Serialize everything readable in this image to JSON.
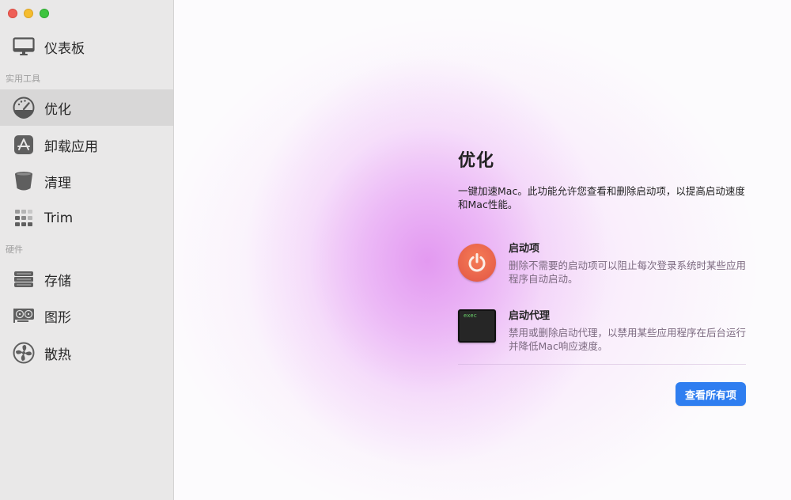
{
  "window": {
    "controls": [
      "close",
      "minimize",
      "maximize"
    ]
  },
  "sidebar": {
    "top_item": {
      "label": "仪表板",
      "icon": "monitor-icon"
    },
    "sections": [
      {
        "label": "实用工具",
        "items": [
          {
            "label": "优化",
            "icon": "gauge-icon",
            "selected": true
          },
          {
            "label": "卸载应用",
            "icon": "app-store-icon",
            "selected": false
          },
          {
            "label": "清理",
            "icon": "bin-icon",
            "selected": false
          },
          {
            "label": "Trim",
            "icon": "grid-icon",
            "selected": false
          }
        ]
      },
      {
        "label": "硬件",
        "items": [
          {
            "label": "存储",
            "icon": "storage-icon",
            "selected": false
          },
          {
            "label": "图形",
            "icon": "graphics-card-icon",
            "selected": false
          },
          {
            "label": "散热",
            "icon": "fan-icon",
            "selected": false
          }
        ]
      }
    ]
  },
  "main": {
    "title": "优化",
    "description": "一键加速Mac。此功能允许您查看和删除启动项，以提高启动速度和Mac性能。",
    "features": [
      {
        "title": "启动项",
        "text": "删除不需要的启动项可以阻止每次登录系统时某些应用程序自动启动。",
        "icon": "power-icon"
      },
      {
        "title": "启动代理",
        "text": "禁用或删除启动代理，以禁用某些应用程序在后台运行并降低Mac响应速度。",
        "icon": "exec-terminal-icon",
        "icon_text": "exec"
      }
    ],
    "view_all_button": "查看所有项",
    "accent_color": "#2f7ef0"
  }
}
